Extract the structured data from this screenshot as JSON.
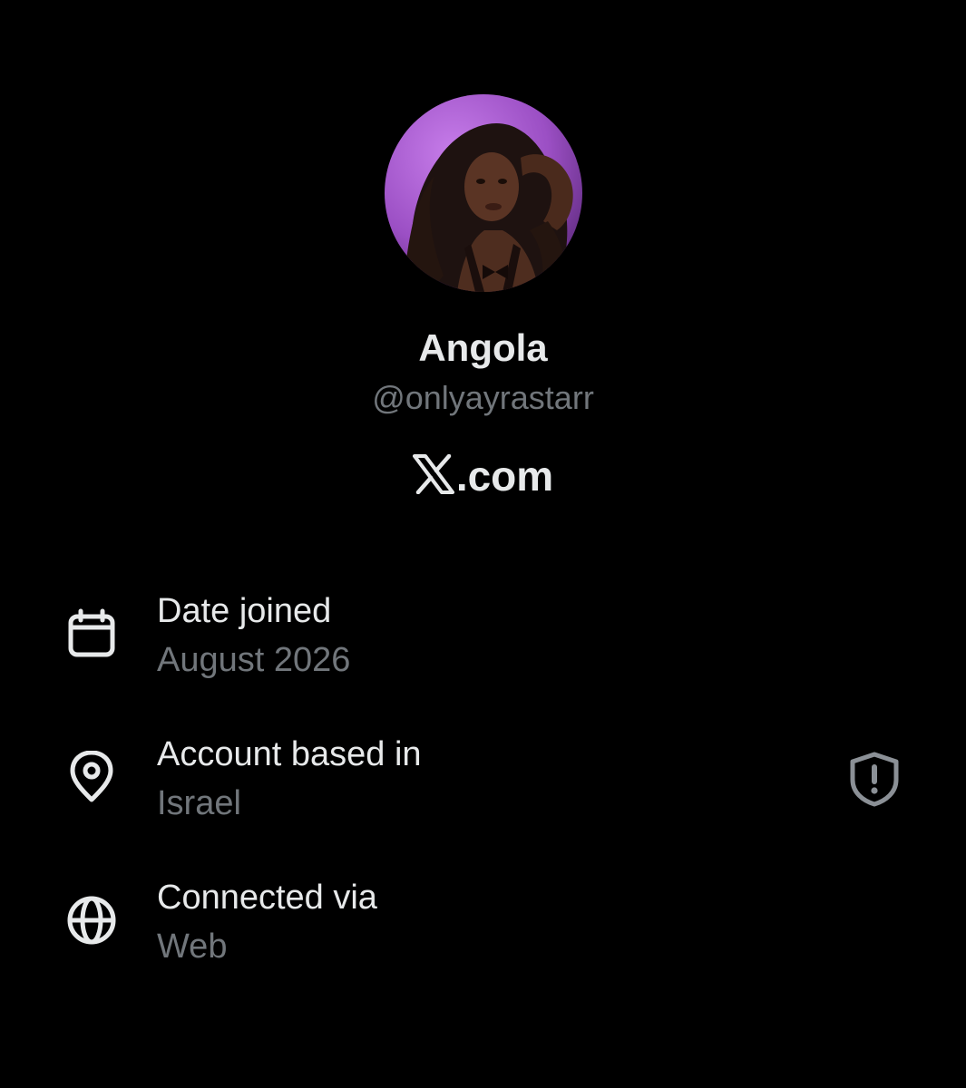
{
  "profile": {
    "display_name": "Angola",
    "handle": "@onlyayrastarr",
    "site": ".com",
    "site_logo_icon": "x-logo-icon",
    "avatar_colors": {
      "background": "#9b4fc4",
      "highlight": "#c77dea",
      "skin": "#5a3424",
      "hair": "#1e1210"
    }
  },
  "about": {
    "rows": [
      {
        "icon": "calendar-icon",
        "label": "Date joined",
        "value": "August 2026"
      },
      {
        "icon": "location-pin-icon",
        "label": "Account based in",
        "value": "Israel",
        "action_icon": "shield-alert-icon"
      },
      {
        "icon": "globe-icon",
        "label": "Connected via",
        "value": "Web"
      }
    ]
  },
  "colors": {
    "background": "#000000",
    "primary_text": "#e7e9ea",
    "secondary_text": "#71767b"
  }
}
